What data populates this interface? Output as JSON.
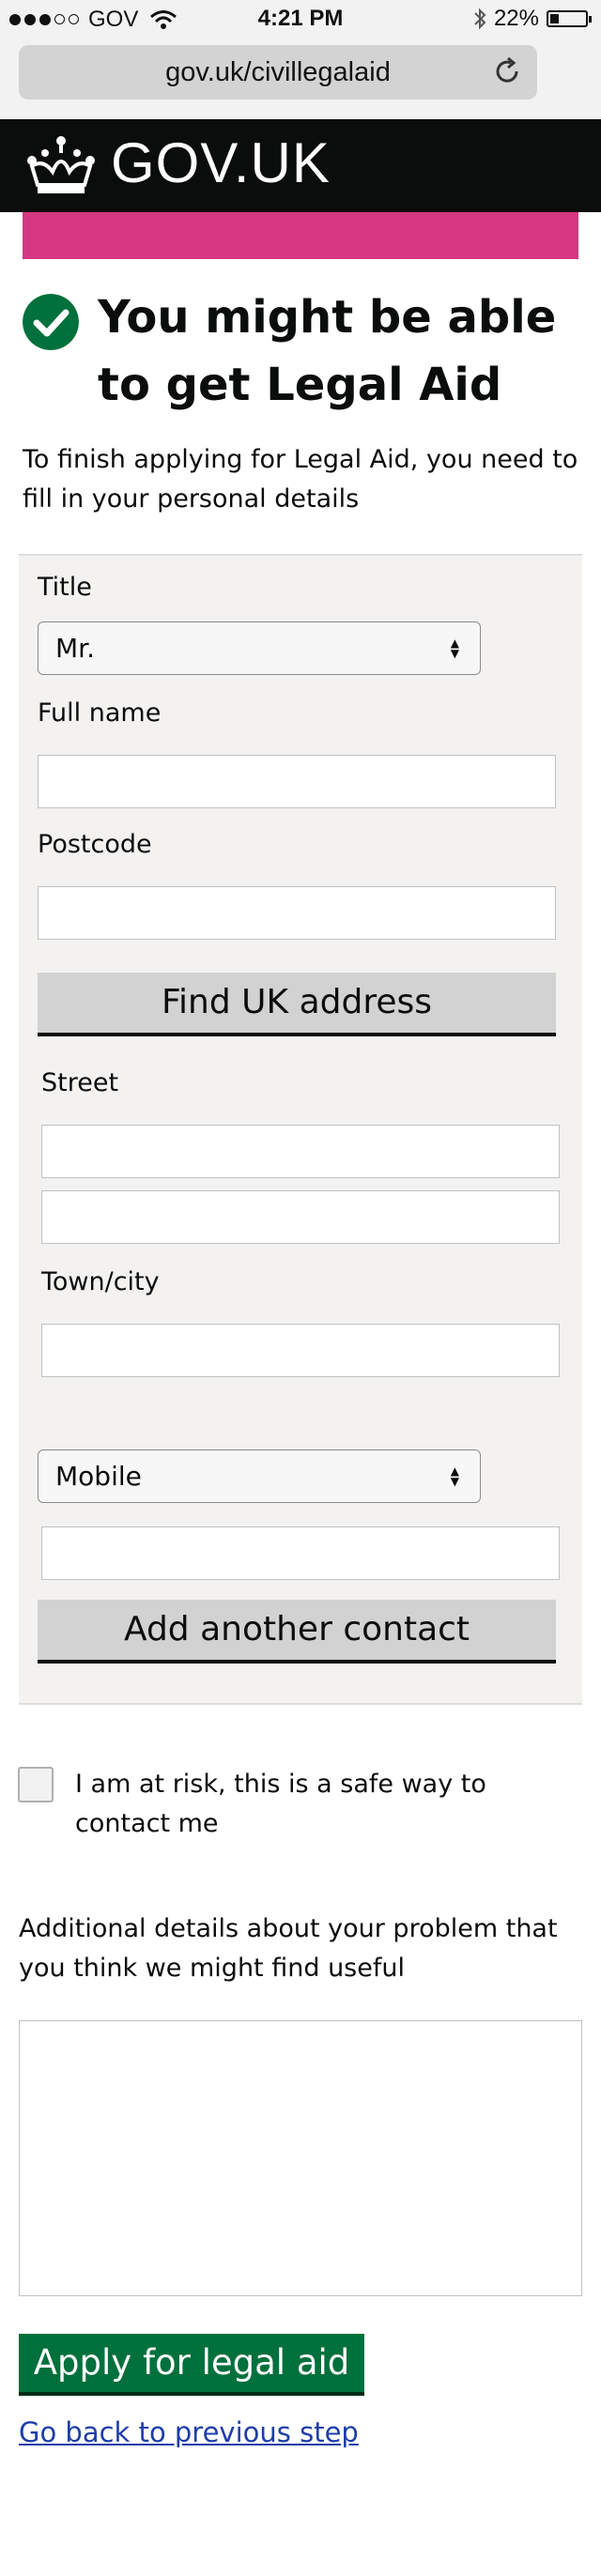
{
  "status_bar": {
    "carrier": "GOV",
    "time": "4:21 PM",
    "battery": "22%"
  },
  "browser": {
    "url": "gov.uk/civillegalaid"
  },
  "header": {
    "logo_text": "GOV.UK"
  },
  "heading": "You might be able to get Legal Aid",
  "intro": "To finish applying for Legal Aid, you need to fill in your personal details",
  "form": {
    "title_label": "Title",
    "title_value": "Mr.",
    "full_name_label": "Full name",
    "postcode_label": "Postcode",
    "find_address_button": "Find UK address",
    "street_label": "Street",
    "town_label": "Town/city",
    "contact_type_value": "Mobile",
    "add_contact_button": "Add another contact"
  },
  "risk_checkbox_label": "I am at risk, this is a safe way to contact me",
  "details_label": "Additional details about your problem that you think we might find useful",
  "apply_button": "Apply for legal aid",
  "back_link": "Go back to previous step",
  "colors": {
    "pink_bar": "#d53880",
    "green": "#00703c",
    "header_bg": "#0b0c0c",
    "link": "#1d3ea8"
  },
  "icons": [
    "signal-dots-icon",
    "wifi-icon",
    "bluetooth-icon",
    "battery-icon",
    "reload-icon",
    "crown-icon",
    "tick-icon",
    "select-arrows-icon"
  ]
}
